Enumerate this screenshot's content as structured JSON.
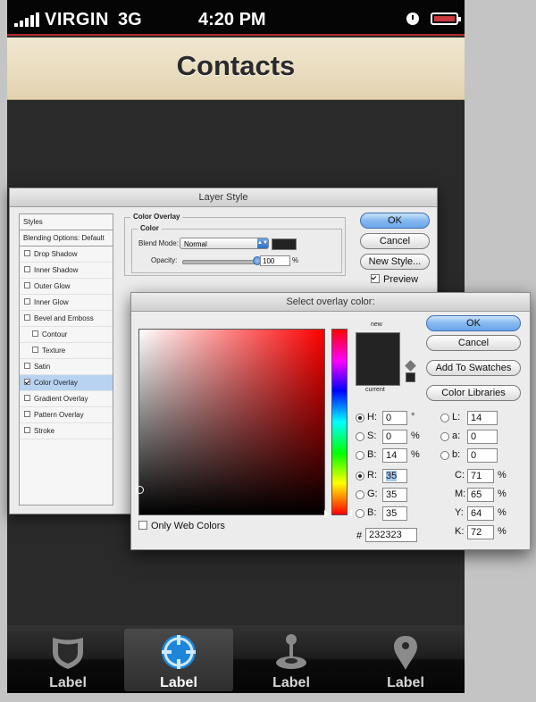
{
  "status_bar": {
    "carrier": "VIRGIN",
    "network": "3G",
    "time": "4:20 PM"
  },
  "nav": {
    "title": "Contacts"
  },
  "tabs": [
    {
      "label": "Label",
      "icon": "shield-icon",
      "active": false
    },
    {
      "label": "Label",
      "icon": "crosshair-icon",
      "active": true
    },
    {
      "label": "Label",
      "icon": "joystick-icon",
      "active": false
    },
    {
      "label": "Label",
      "icon": "map-pin-icon",
      "active": false
    }
  ],
  "layer_style": {
    "title": "Layer Style",
    "styles_header": "Styles",
    "blending_options": "Blending Options: Default",
    "items": [
      {
        "label": "Drop Shadow",
        "checked": false
      },
      {
        "label": "Inner Shadow",
        "checked": false
      },
      {
        "label": "Outer Glow",
        "checked": false
      },
      {
        "label": "Inner Glow",
        "checked": false
      },
      {
        "label": "Bevel and Emboss",
        "checked": false
      },
      {
        "label": "Contour",
        "checked": false
      },
      {
        "label": "Texture",
        "checked": false
      },
      {
        "label": "Satin",
        "checked": false
      },
      {
        "label": "Color Overlay",
        "checked": true
      },
      {
        "label": "Gradient Overlay",
        "checked": false
      },
      {
        "label": "Pattern Overlay",
        "checked": false
      },
      {
        "label": "Stroke",
        "checked": false
      }
    ],
    "group_title": "Color Overlay",
    "subgroup_title": "Color",
    "blend_mode_label": "Blend Mode:",
    "blend_mode_value": "Normal",
    "opacity_label": "Opacity:",
    "opacity_value": "100",
    "opacity_unit": "%",
    "opacity_fraction": 1.0,
    "overlay_color": "#232323",
    "ok_label": "OK",
    "cancel_label": "Cancel",
    "new_style_label": "New Style...",
    "preview_label": "Preview",
    "preview_checked": true
  },
  "color_picker": {
    "title": "Select overlay color:",
    "new_label": "new",
    "current_label": "current",
    "ok_label": "OK",
    "cancel_label": "Cancel",
    "add_swatches_label": "Add To Swatches",
    "color_libraries_label": "Color Libraries",
    "hsb": [
      {
        "label": "H:",
        "value": "0",
        "unit": "°",
        "selected": true
      },
      {
        "label": "S:",
        "value": "0",
        "unit": "%",
        "selected": false
      },
      {
        "label": "B:",
        "value": "14",
        "unit": "%",
        "selected": false
      }
    ],
    "rgb": [
      {
        "label": "R:",
        "value": "35",
        "selected": false
      },
      {
        "label": "G:",
        "value": "35",
        "selected": false
      },
      {
        "label": "B:",
        "value": "35",
        "selected": false
      }
    ],
    "lab": [
      {
        "label": "L:",
        "value": "14"
      },
      {
        "label": "a:",
        "value": "0"
      },
      {
        "label": "b:",
        "value": "0"
      }
    ],
    "cmyk": [
      {
        "label": "C:",
        "value": "71",
        "unit": "%"
      },
      {
        "label": "M:",
        "value": "65",
        "unit": "%"
      },
      {
        "label": "Y:",
        "value": "64",
        "unit": "%"
      },
      {
        "label": "K:",
        "value": "72",
        "unit": "%"
      }
    ],
    "hex_prefix": "#",
    "hex_value": "232323",
    "only_web_colors_label": "Only Web Colors",
    "only_web_colors_checked": false
  }
}
